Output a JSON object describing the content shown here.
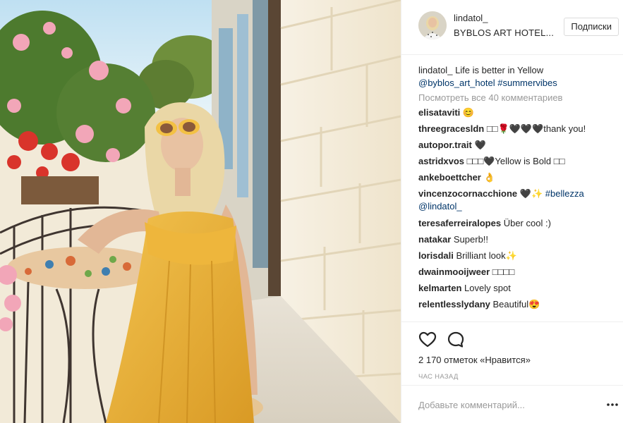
{
  "header": {
    "username": "lindatol_",
    "location": "BYBLOS ART HOTEL...",
    "follow_label": "Подписки"
  },
  "caption": {
    "username": "lindatol_",
    "text": "Life is better in Yellow",
    "mention": "@byblos_art_hotel",
    "hashtag": "#summervibes"
  },
  "view_all_comments": "Посмотреть все 40 комментариев",
  "comments": [
    {
      "username": "elisataviti",
      "text": "😊"
    },
    {
      "username": "threegracesldn",
      "text": "□□🌹🖤🖤🖤thank you!"
    },
    {
      "username": "autopor.trait",
      "text": "🖤"
    },
    {
      "username": "astridxvos",
      "text": "□□□🖤Yellow is Bold □□"
    },
    {
      "username": "ankeboettcher",
      "text": "👌"
    },
    {
      "username": "vincenzocornacchione",
      "text": "🖤✨",
      "hashtag": "#bellezza",
      "mention": "@lindatol_"
    },
    {
      "username": "teresaferreiralopes",
      "text": "Über cool :)"
    },
    {
      "username": "natakar",
      "text": "Superb!!"
    },
    {
      "username": "lorisdali",
      "text": "Brilliant look✨"
    },
    {
      "username": "dwainmooijweer",
      "text": "□□□□"
    },
    {
      "username": "kelmarten",
      "text": "Lovely spot"
    },
    {
      "username": "relentlesslydany",
      "text": "Beautiful😍"
    }
  ],
  "likes": "2 170 отметок «Нравится»",
  "time": "ЧАС НАЗАД",
  "add_comment": {
    "placeholder": "Добавьте комментарий..."
  },
  "icons": {
    "like": "heart-outline-icon",
    "comment": "speech-bubble-icon",
    "more": "more-horizontal-icon"
  },
  "colors": {
    "link": "#003569",
    "muted": "#999999",
    "text": "#262626",
    "border": "#efefef"
  }
}
